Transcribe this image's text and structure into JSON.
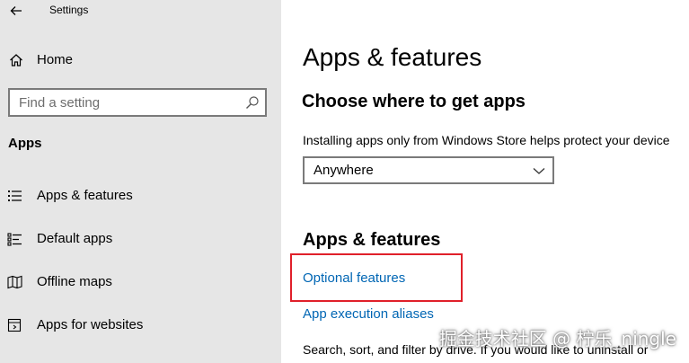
{
  "window": {
    "title": "Settings"
  },
  "sidebar": {
    "home_label": "Home",
    "search_placeholder": "Find a setting",
    "section_label": "Apps",
    "items": [
      {
        "label": "Apps & features",
        "icon": "list-icon"
      },
      {
        "label": "Default apps",
        "icon": "default-apps-icon"
      },
      {
        "label": "Offline maps",
        "icon": "map-icon"
      },
      {
        "label": "Apps for websites",
        "icon": "web-apps-icon"
      }
    ]
  },
  "main": {
    "title": "Apps & features",
    "choose_heading": "Choose where to get apps",
    "choose_description": "Installing apps only from Windows Store helps protect your device",
    "source_dropdown": {
      "value": "Anywhere"
    },
    "features_heading": "Apps & features",
    "optional_features_link": "Optional features",
    "execution_aliases_link": "App execution aliases",
    "search_description": "Search, sort, and filter by drive. If you would like to uninstall or"
  },
  "watermark": "掘金技术社区 @ 柠乐_ningle",
  "colors": {
    "sidebar_bg": "#e6e6e6",
    "link": "#0066b4",
    "highlight": "#e0202a"
  }
}
